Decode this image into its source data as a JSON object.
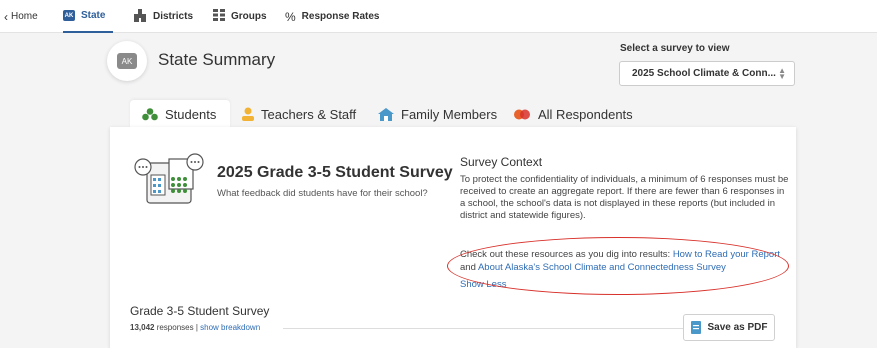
{
  "nav": {
    "home_label": "Home",
    "state_badge": "AK",
    "state_label": "State",
    "districts_label": "Districts",
    "groups_label": "Groups",
    "rates_label": "Response Rates"
  },
  "header": {
    "badge": "AK",
    "title": "State Summary",
    "select_label": "Select a survey to view",
    "select_value": "2025 School Climate & Conn..."
  },
  "tabs": [
    {
      "label": "Students"
    },
    {
      "label": "Teachers & Staff"
    },
    {
      "label": "Family Members"
    },
    {
      "label": "All Respondents"
    }
  ],
  "survey": {
    "title": "2025 Grade 3-5 Student Survey",
    "subtitle": "What feedback did students have for their school?"
  },
  "context": {
    "title": "Survey Context",
    "body": "To protect the confidentiality of individuals, a minimum of 6 responses must be received to create an aggregate report. If there are fewer than 6 responses in a school, the school's data is not displayed in these reports (but included in district and statewide figures).",
    "resources_prefix": "Check out these resources as you dig into results: ",
    "link1": "How to Read your Report",
    "resources_middle": " and ",
    "link2": "About Alaska's School Climate and Connectedness Survey",
    "show_less": "Show Less"
  },
  "summary": {
    "title": "Grade 3-5 Student Survey",
    "responses_count": "13,042",
    "responses_suffix": " responses | ",
    "breakdown_link": "show breakdown",
    "pdf_label": "Save as PDF"
  },
  "colors": {
    "accent": "#2f5f9a",
    "link": "#2f6db5",
    "annotation": "#d8302a"
  }
}
